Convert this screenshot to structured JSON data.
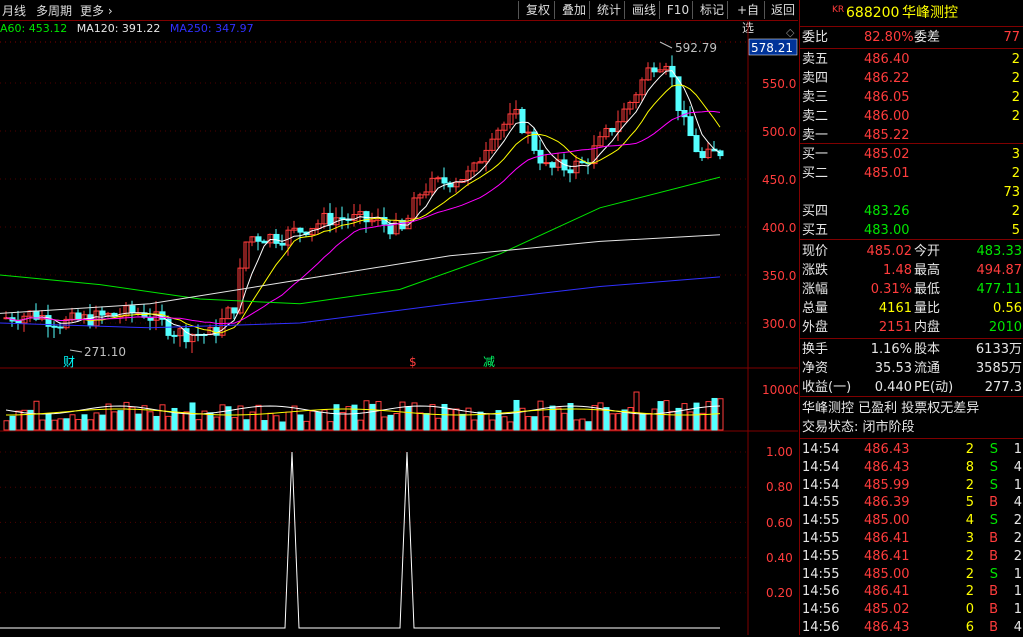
{
  "toolbar": {
    "period": "月线",
    "multi_period": "多周期",
    "more": "更多",
    "buttons": [
      "复权",
      "叠加",
      "统计",
      "画线",
      "F10",
      "标记",
      "+自选",
      "返回"
    ]
  },
  "ma_legend": [
    {
      "label": "A60: 453.12",
      "color": "#00e600"
    },
    {
      "label": "MA120: 391.22",
      "color": "#e6e6e6"
    },
    {
      "label": "MA250: 347.97",
      "color": "#3030ff"
    }
  ],
  "main_chart": {
    "y_ticks": [
      "550.0",
      "500.0",
      "450.0",
      "400.0",
      "350.0",
      "300.0"
    ],
    "current_price_tag": "578.21",
    "high_label": "592.79",
    "low_label": "271.10",
    "markers": [
      "财",
      "$",
      "减"
    ]
  },
  "volume_chart": {
    "y_ticks": [
      "10000"
    ]
  },
  "indicator_chart": {
    "y_ticks": [
      "1.00",
      "0.80",
      "0.60",
      "0.40",
      "0.20"
    ]
  },
  "quote": {
    "badge": "KR",
    "code": "688200",
    "name": "华峰测控",
    "weibi_label": "委比",
    "weibi_value": "82.80%",
    "weicha_label": "委差",
    "weicha_value": "77",
    "asks": [
      {
        "label": "卖五",
        "price": "486.40",
        "vol": "2"
      },
      {
        "label": "卖四",
        "price": "486.22",
        "vol": "2"
      },
      {
        "label": "卖三",
        "price": "486.05",
        "vol": "2"
      },
      {
        "label": "卖二",
        "price": "486.00",
        "vol": "2"
      },
      {
        "label": "卖一",
        "price": "485.22",
        "vol": ""
      }
    ],
    "bids": [
      {
        "label": "买一",
        "price": "485.02",
        "vol": "3"
      },
      {
        "label": "买二",
        "price": "485.01",
        "vol": "2"
      },
      {
        "label": "",
        "price": "",
        "vol": "73"
      },
      {
        "label": "买四",
        "price": "483.26",
        "vol": "2"
      },
      {
        "label": "买五",
        "price": "483.00",
        "vol": "5"
      }
    ],
    "stats": [
      {
        "l1": "现价",
        "v1": "485.02",
        "c1": "red",
        "l2": "今开",
        "v2": "483.33",
        "c2": "grn"
      },
      {
        "l1": "涨跌",
        "v1": "1.48",
        "c1": "red",
        "l2": "最高",
        "v2": "494.87",
        "c2": "red"
      },
      {
        "l1": "涨幅",
        "v1": "0.31%",
        "c1": "red",
        "l2": "最低",
        "v2": "477.11",
        "c2": "grn"
      },
      {
        "l1": "总量",
        "v1": "4161",
        "c1": "yel",
        "l2": "量比",
        "v2": "0.56",
        "c2": "yel"
      },
      {
        "l1": "外盘",
        "v1": "2151",
        "c1": "red",
        "l2": "内盘",
        "v2": "2010",
        "c2": "grn"
      }
    ],
    "fundamentals": [
      {
        "l1": "换手",
        "v1": "1.16%",
        "l2": "股本",
        "v2": "6133万"
      },
      {
        "l1": "净资",
        "v1": "35.53",
        "l2": "流通",
        "v2": "3585万"
      },
      {
        "l1": "收益(一)",
        "v1": "0.440",
        "l2": "PE(动)",
        "v2": "277.3"
      }
    ],
    "info_line": "华峰测控 已盈利 投票权无差异",
    "status_line": "交易状态: 闭市阶段",
    "ticks": [
      {
        "t": "14:54",
        "p": "486.43",
        "v": "2",
        "s": "S",
        "n": "1"
      },
      {
        "t": "14:54",
        "p": "486.43",
        "v": "8",
        "s": "S",
        "n": "4"
      },
      {
        "t": "14:54",
        "p": "485.99",
        "v": "2",
        "s": "S",
        "n": "1"
      },
      {
        "t": "14:55",
        "p": "486.39",
        "v": "5",
        "s": "B",
        "n": "4"
      },
      {
        "t": "14:55",
        "p": "485.00",
        "v": "4",
        "s": "S",
        "n": "2"
      },
      {
        "t": "14:55",
        "p": "486.41",
        "v": "3",
        "s": "B",
        "n": "2"
      },
      {
        "t": "14:55",
        "p": "486.41",
        "v": "2",
        "s": "B",
        "n": "2"
      },
      {
        "t": "14:55",
        "p": "485.00",
        "v": "2",
        "s": "S",
        "n": "1"
      },
      {
        "t": "14:56",
        "p": "486.41",
        "v": "2",
        "s": "B",
        "n": "1"
      },
      {
        "t": "14:56",
        "p": "485.02",
        "v": "0",
        "s": "B",
        "n": "1"
      },
      {
        "t": "14:56",
        "p": "486.43",
        "v": "6",
        "s": "B",
        "n": "4"
      }
    ]
  },
  "colors": {
    "up": "#ff3c3c",
    "down": "#54ffff",
    "border": "#800000",
    "ma5": "#ffffff",
    "ma10": "#ffff00",
    "ma20": "#ff00ff"
  }
}
